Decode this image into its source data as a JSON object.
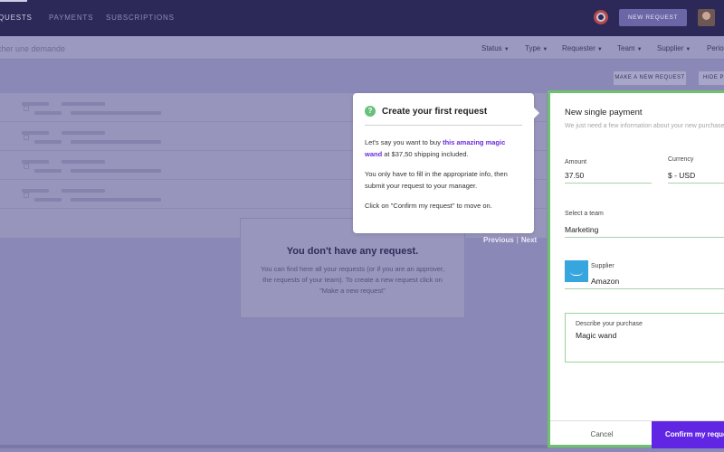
{
  "nav": {
    "tabs": [
      {
        "label": "QUESTS"
      },
      {
        "label": "PAYMENTS"
      },
      {
        "label": "SUBSCRIPTIONS"
      }
    ],
    "new_request_label": "NEW REQUEST"
  },
  "filterbar": {
    "search_placeholder": "rcher une demande",
    "filters": [
      "Status",
      "Type",
      "Requester",
      "Team",
      "Supplier",
      "Perio"
    ]
  },
  "actions": {
    "make_request": "MAKE A NEW REQUEST",
    "hide": "HIDE P"
  },
  "empty_state": {
    "title": "You don't have any request.",
    "body": "You can find here all your requests (or if you are an approver, the requests of your team). To create a new request click on \"Make a new request\""
  },
  "pager": {
    "previous": "Previous",
    "separator": "|",
    "next": "Next"
  },
  "tooltip": {
    "icon": "question-icon",
    "title": "Create your first request",
    "p1_before": "Let's say you want to buy ",
    "p1_link": "this amazing magic wand",
    "p1_after": " at $37,50 shipping included.",
    "p2": "You only have to fill in the appropriate info, then submit your request to your manager.",
    "p3": "Click on \"Confirm my request\" to move on."
  },
  "form": {
    "title": "New single payment",
    "subtitle": "We just need a few information about your new purchase",
    "amount_label": "Amount",
    "amount_value": "37.50",
    "currency_label": "Currency",
    "currency_value": "$ - USD",
    "team_label": "Select a team",
    "team_value": "Marketing",
    "supplier_label": "Supplier",
    "supplier_value": "Amazon",
    "description_label": "Describe your purchase",
    "description_value": "Magic wand",
    "cancel_label": "Cancel",
    "confirm_label": "Confirm my request"
  },
  "colors": {
    "nav_bg": "#2c2858",
    "accent": "#6126e4",
    "highlight_border": "#6fc26c",
    "overlay": "#8a88b6"
  }
}
